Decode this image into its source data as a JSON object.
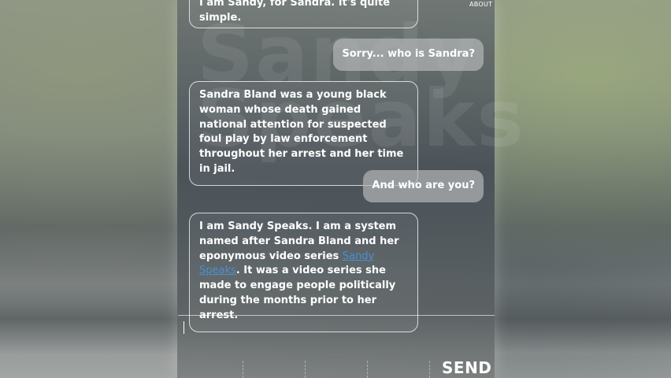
{
  "header": {
    "about_label": "ABOUT"
  },
  "watermark": {
    "line1": "Sandy",
    "line2": "Speaks"
  },
  "messages": {
    "top_bot_line1": "I am Sandy, for Sandra. It's quite",
    "top_bot_line2": "simple.",
    "user_1": "Sorry... who is Sandra?",
    "bot_1": "Sandra Bland was a young black woman whose death gained national attention for suspected foul play by law enforcement throughout her arrest and her time in jail.",
    "user_2": "And who are you?",
    "bot_2_before": "I am Sandy Speaks. I am a system named after Sandra Bland and her eponymous video series ",
    "bot_2_link": "Sandy Speaks",
    "bot_2_after": ". It was a video series she made to engage people politically during the months prior to her arrest."
  },
  "composer": {
    "input_value": "",
    "send_label": "SEND"
  },
  "colors": {
    "link": "#4a8fd4",
    "text": "#ffffff"
  }
}
